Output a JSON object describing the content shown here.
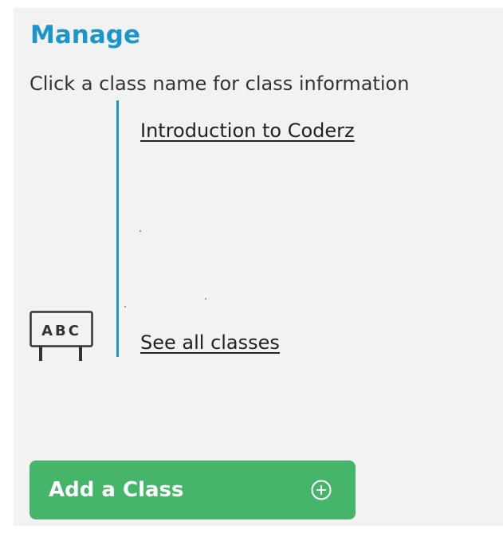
{
  "manage": {
    "title": "Manage",
    "subtitle": "Click a class name for class information",
    "classes": [
      {
        "label": "Introduction to Coderz"
      }
    ],
    "see_all_label": "See all classes",
    "board_icon": {
      "icon": "chalkboard-abc-icon",
      "text": "ABC"
    },
    "accent_color": "#1b96c9"
  },
  "add_class": {
    "label": "Add a Class",
    "icon": "plus-circle-icon",
    "color": "#45b56a"
  }
}
